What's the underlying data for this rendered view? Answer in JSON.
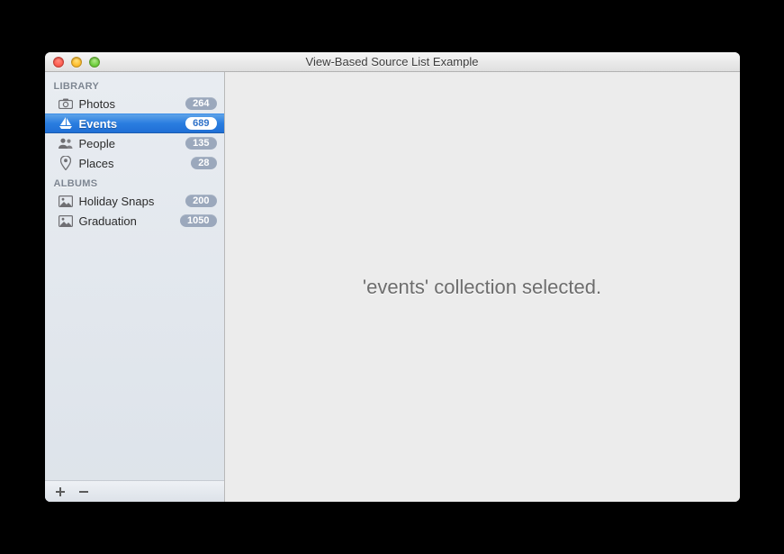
{
  "window": {
    "title": "View-Based Source List Example"
  },
  "sidebar": {
    "groups": [
      {
        "header": "LIBRARY",
        "items": [
          {
            "icon": "camera-icon",
            "label": "Photos",
            "badge": "264",
            "selected": false
          },
          {
            "icon": "sailboat-icon",
            "label": "Events",
            "badge": "689",
            "selected": true
          },
          {
            "icon": "people-icon",
            "label": "People",
            "badge": "135",
            "selected": false
          },
          {
            "icon": "pin-icon",
            "label": "Places",
            "badge": "28",
            "selected": false
          }
        ]
      },
      {
        "header": "ALBUMS",
        "items": [
          {
            "icon": "picture-icon",
            "label": "Holiday Snaps",
            "badge": "200",
            "selected": false
          },
          {
            "icon": "picture-icon",
            "label": "Graduation",
            "badge": "1050",
            "selected": false
          }
        ]
      }
    ]
  },
  "content": {
    "message": "'events' collection selected."
  }
}
